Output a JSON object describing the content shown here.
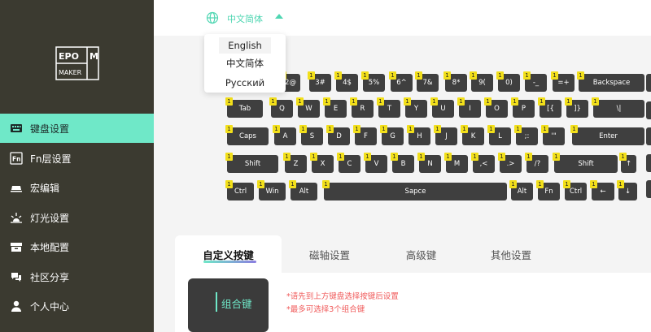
{
  "sidebar": {
    "logo_text": "EPOMAKER",
    "items": [
      {
        "label": "键盘设置",
        "icon": "keyboard-icon",
        "active": true
      },
      {
        "label": "Fn层设置",
        "icon": "fn-layer-icon",
        "active": false
      },
      {
        "label": "宏编辑",
        "icon": "macro-icon",
        "active": false
      },
      {
        "label": "灯光设置",
        "icon": "light-icon",
        "active": false
      },
      {
        "label": "本地配置",
        "icon": "storage-icon",
        "active": false
      },
      {
        "label": "社区分享",
        "icon": "community-icon",
        "active": false
      },
      {
        "label": "个人中心",
        "icon": "user-icon",
        "active": false
      }
    ]
  },
  "header": {
    "language_current": "中文简体",
    "language_options": [
      "English",
      "中文简体",
      "Русский"
    ]
  },
  "keyboard": {
    "layer_badge": "1",
    "rows": [
      [
        "2@",
        "3#",
        "4$",
        "5%",
        "6^",
        "7&",
        "8*",
        "9(",
        "0)",
        "-_",
        "=+",
        "Backspace"
      ],
      [
        "Tab",
        "Q",
        "W",
        "E",
        "R",
        "T",
        "Y",
        "U",
        "I",
        "O",
        "P",
        "[{",
        "]}",
        "\\|"
      ],
      [
        "Caps",
        "A",
        "S",
        "D",
        "F",
        "G",
        "H",
        "J",
        "K",
        "L",
        ";:",
        "'\"",
        "Enter"
      ],
      [
        "Shift",
        "Z",
        "X",
        "C",
        "V",
        "B",
        "N",
        "M",
        ",<",
        ".>",
        "/?",
        "Shift",
        "↑"
      ],
      [
        "Ctrl",
        "Win",
        "Alt",
        "Sapce",
        "Alt",
        "Fn",
        "Ctrl",
        "←",
        "↓"
      ]
    ]
  },
  "tabs": [
    {
      "label": "自定义按键",
      "active": true
    },
    {
      "label": "磁轴设置",
      "active": false
    },
    {
      "label": "高级键",
      "active": false
    },
    {
      "label": "其他设置",
      "active": false
    }
  ],
  "panel": {
    "combo_key_label": "组合键",
    "hint_1": "*请先到上方键盘选择按键后设置",
    "hint_2": "*最多可选择3个组合键"
  },
  "colors": {
    "sidebar_bg": "#3b3a30",
    "accent": "#6fe8c8",
    "key_bg": "#3f3f3f",
    "badge": "#f2df1a",
    "hint": "#f05a5a"
  }
}
